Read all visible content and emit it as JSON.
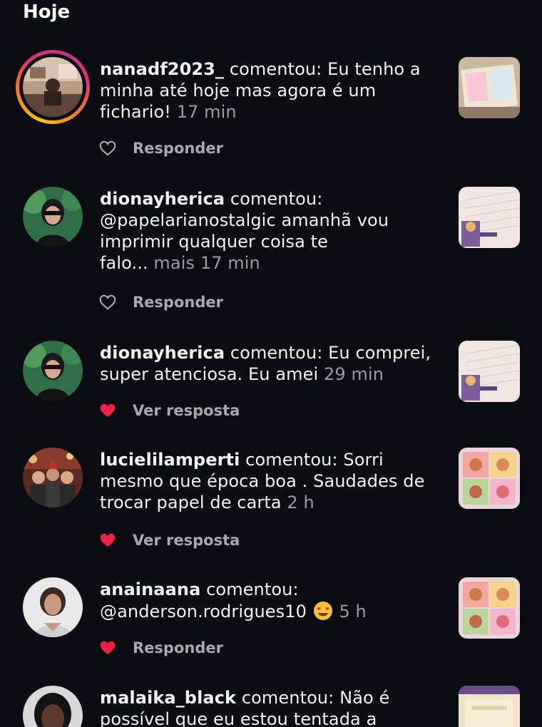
{
  "section": {
    "title": "Hoje"
  },
  "notifications": [
    {
      "username": "nanadf2023_",
      "verb": "comentou:",
      "line1_rest": "Eu tenho a",
      "line2": "minha até hoje mas agora é um",
      "line3": "fichario!",
      "time": "17 min",
      "liked": false,
      "action": "Responder",
      "has_story_ring": true
    },
    {
      "username": "dionayherica",
      "verb": "comentou:",
      "line2": "@papelarianostalgic  amanhã vou",
      "line3": "imprimir qualquer coisa te",
      "line4": "falo...",
      "more": "mais",
      "time": "17 min",
      "liked": false,
      "action": "Responder"
    },
    {
      "username": "dionayherica",
      "verb": "comentou:",
      "line1_rest": "Eu comprei,",
      "line2": "super atenciosa. Eu amei",
      "time": "29 min",
      "liked": true,
      "action": "Ver resposta"
    },
    {
      "username": "lucielilamperti",
      "verb": "comentou:",
      "line1_rest": "Sorri",
      "line2": "mesmo que época boa . Saudades de",
      "line3": "trocar papel de carta",
      "time": "2 h",
      "liked": true,
      "action": "Ver resposta"
    },
    {
      "username": "anainaana",
      "verb": "comentou:",
      "line2": "@anderson.rodrigues10",
      "emoji": "heart-eyes-emoji",
      "time": "5 h",
      "liked": true,
      "action": "Responder"
    },
    {
      "username": "malaika_black",
      "verb": "comentou:",
      "line1_rest": "Não é",
      "line2": "possível que eu estou tentada a"
    }
  ],
  "colors": {
    "background": "#0c0d12",
    "text": "#f2f2f2",
    "muted": "#9a9aa2",
    "like_red": "#ed2045"
  }
}
